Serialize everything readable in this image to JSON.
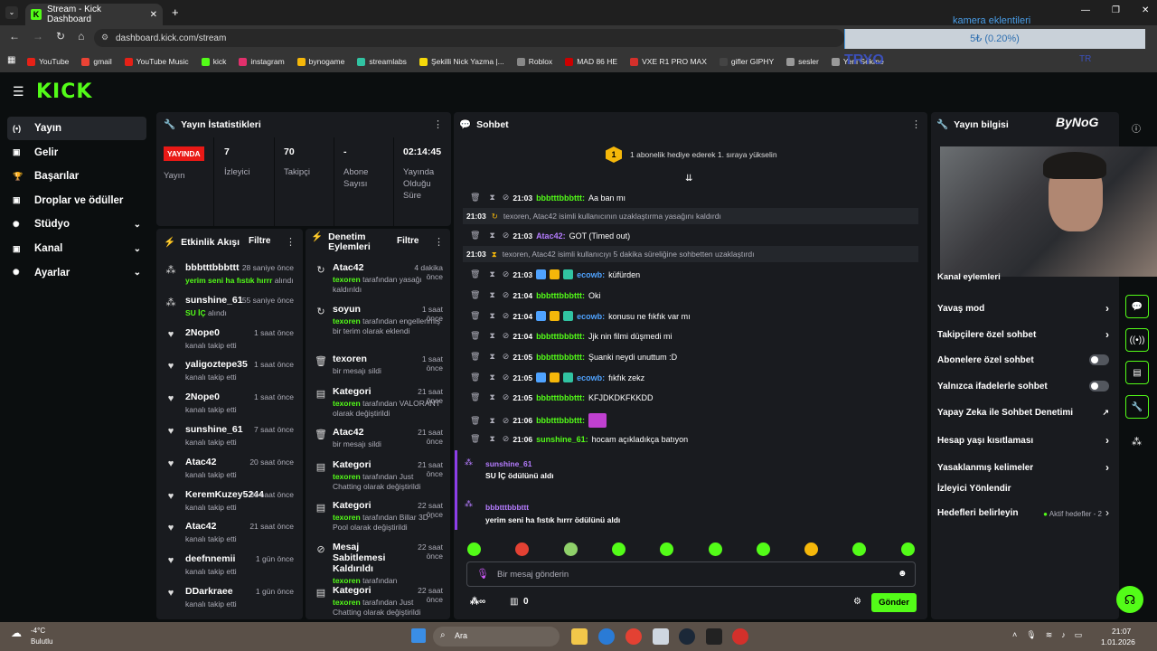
{
  "browser": {
    "tab_title": "Stream - Kick Dashboard",
    "url": "dashboard.kick.com/stream",
    "bookmarks": [
      "YouTube",
      "gmail",
      "YouTube Music",
      "kick",
      "instagram",
      "bynogame",
      "streamlabs",
      "Şekilli Nick Yazma |...",
      "Roblox",
      "MAD 86 HE",
      "VXE R1 PRO MAX",
      "gifler GIPHY",
      "sesler",
      "Yeni Sekme"
    ]
  },
  "overlay": {
    "title": "kamera eklentileri",
    "progress_text": "5₺ (0.20%)",
    "tryo": "TRYO",
    "tr": "TR",
    "bynogame": "ByNoG"
  },
  "sidebar": {
    "items": [
      {
        "label": "Yayın",
        "icon": "(•)"
      },
      {
        "label": "Gelir",
        "icon": "▣"
      },
      {
        "label": "Başarılar",
        "icon": "🏆"
      },
      {
        "label": "Droplar ve ödüller",
        "icon": "▣"
      },
      {
        "label": "Stüdyo",
        "icon": "✺"
      },
      {
        "label": "Kanal",
        "icon": "▣"
      },
      {
        "label": "Ayarlar",
        "icon": "✺"
      }
    ]
  },
  "stats": {
    "title": "Yayın İstatistikleri",
    "live": "YAYINDA",
    "live_label": "Yayın",
    "viewers": "7",
    "viewers_label": "İzleyici",
    "followers": "70",
    "followers_label": "Takipçi",
    "subs": "-",
    "subs_label": "Abone Sayısı",
    "uptime": "02:14:45",
    "uptime_label": "Yayında Olduğu Süre"
  },
  "activity": {
    "title": "Etkinlik Akışı",
    "filter": "Filtre",
    "items": [
      {
        "user": "bbbtttbbbttt",
        "time": "28 saniye önce",
        "text": "yerim seni ha fıstık hırrr",
        "suffix": " alındı",
        "green": true
      },
      {
        "user": "sunshine_61",
        "time": "55 saniye önce",
        "text": "SU İÇ",
        "suffix": " alındı",
        "green": true
      },
      {
        "user": "2Nope0",
        "time": "1 saat önce",
        "text": "kanalı takip etti"
      },
      {
        "user": "yaligoztepe35",
        "time": "1 saat önce",
        "text": "kanalı takip etti"
      },
      {
        "user": "2Nope0",
        "time": "1 saat önce",
        "text": "kanalı takip etti"
      },
      {
        "user": "sunshine_61",
        "time": "7 saat önce",
        "text": "kanalı takip etti"
      },
      {
        "user": "Atac42",
        "time": "20 saat önce",
        "text": "kanalı takip etti"
      },
      {
        "user": "KeremKuzey5244",
        "time": "20 saat önce",
        "text": "kanalı takip etti"
      },
      {
        "user": "Atac42",
        "time": "21 saat önce",
        "text": "kanalı takip etti"
      },
      {
        "user": "deefnnemii",
        "time": "1 gün önce",
        "text": "kanalı takip etti"
      },
      {
        "user": "DDarkraee",
        "time": "1 gün önce",
        "text": "kanalı takip etti"
      }
    ]
  },
  "moderation": {
    "title": "Denetim Eylemleri",
    "filter": "Filtre",
    "items": [
      {
        "title": "Atac42",
        "time": "4 dakika önce",
        "actor": "texoren",
        "text": " tarafından yasağı kaldırıldı",
        "icon": "↻"
      },
      {
        "title": "soyun",
        "time": "1 saat önce",
        "actor": "texoren",
        "text": " tarafından engellenmiş bir terim olarak eklendi",
        "icon": "↻"
      },
      {
        "title": "texoren",
        "time": "1 saat önce",
        "actor": "",
        "text": "bir mesajı sildi",
        "icon": "🗑"
      },
      {
        "title": "Kategori",
        "time": "21 saat önce",
        "actor": "texoren",
        "text": " tarafından VALORANT olarak değiştirildi",
        "icon": "▤"
      },
      {
        "title": "Atac42",
        "time": "21 saat önce",
        "actor": "",
        "text": "bir mesajı sildi",
        "icon": "🗑"
      },
      {
        "title": "Kategori",
        "time": "21 saat önce",
        "actor": "texoren",
        "text": " tarafından Just Chatting olarak değiştirildi",
        "icon": "▤"
      },
      {
        "title": "Kategori",
        "time": "22 saat önce",
        "actor": "texoren",
        "text": " tarafından Billar 3D - Pool olarak değiştirildi",
        "icon": "▤"
      },
      {
        "title": "Mesaj Sabitlemesi Kaldırıldı",
        "time": "22 saat önce",
        "actor": "texoren",
        "text": " tarafından",
        "icon": "⊘"
      },
      {
        "title": "Kategori",
        "time": "22 saat önce",
        "actor": "texoren",
        "text": " tarafından Just Chatting olarak değiştirildi",
        "icon": "▤"
      }
    ]
  },
  "chat": {
    "title": "Sohbet",
    "banner": "1 abonelik hediye ederek 1. sıraya yükselin",
    "banner_num": "1",
    "lines": [
      {
        "time": "21:03",
        "user": "bbbtttbbbttt",
        "color": "#53fc18",
        "msg": "Aa ban mı"
      },
      {
        "time": "21:03",
        "user": "Atac42",
        "color": "#b57cff",
        "msg": "GOT (Timed out)"
      },
      {
        "time": "21:03",
        "user": "ecowb",
        "color": "#4fa3ff",
        "msg": "küfürden"
      },
      {
        "time": "21:04",
        "user": "bbbtttbbbttt",
        "color": "#53fc18",
        "msg": "Oki"
      },
      {
        "time": "21:04",
        "user": "ecowb",
        "color": "#4fa3ff",
        "msg": "konusu ne fıkfık var mı"
      },
      {
        "time": "21:04",
        "user": "bbbtttbbbttt",
        "color": "#53fc18",
        "msg": "Jjk nin filmi düşmedi mi"
      },
      {
        "time": "21:05",
        "user": "bbbtttbbbttt",
        "color": "#53fc18",
        "msg": "Şuanki neydi unuttum :D"
      },
      {
        "time": "21:05",
        "user": "ecowb",
        "color": "#4fa3ff",
        "msg": "fıkfık zekz"
      },
      {
        "time": "21:05",
        "user": "bbbtttbbbttt",
        "color": "#53fc18",
        "msg": "KFJDKDKFKKDD"
      },
      {
        "time": "21:06",
        "user": "bbbtttbbbttt",
        "color": "#53fc18",
        "msg": ""
      },
      {
        "time": "21:06",
        "user": "sunshine_61",
        "color": "#53fc18",
        "msg": "hocam açıkladıkça batıyon"
      }
    ],
    "sys1_time": "21:03",
    "sys1": "texoren, Atac42 isimli kullanıcının uzaklaştırma yasağını kaldırdı",
    "sys2_time": "21:03",
    "sys2": "texoren, Atac42 isimli kullanıcıyı 5 dakika süreliğine sohbetten uzaklaştırdı",
    "reward1_user": "sunshine_61",
    "reward1_text": "SU İÇ ödülünü aldı",
    "reward2_user": "bbbtttbbbttt",
    "reward2_text": "yerim seni ha fıstık hırrr ödülünü aldı",
    "input_placeholder": "Bir mesaj gönderin",
    "points": "0",
    "send": "Gönder"
  },
  "info": {
    "title": "Yayın bilgisi",
    "mod_label": "Kanal eylemleri",
    "settings": [
      {
        "label": "Yavaş mod",
        "kind": "chev"
      },
      {
        "label": "Takipçilere özel sohbet",
        "kind": "chev"
      },
      {
        "label": "Abonelere özel sohbet",
        "kind": "toggle"
      },
      {
        "label": "Yalnızca ifadelerle sohbet",
        "kind": "toggle"
      },
      {
        "label": "Yapay Zeka ile Sohbet Denetimi",
        "kind": "ext"
      },
      {
        "label": "Hesap yaşı kısıtlaması",
        "kind": "chev"
      },
      {
        "label": "Yasaklanmış kelimeler",
        "kind": "chev"
      },
      {
        "label": "İzleyici Yönlendir",
        "kind": "none"
      },
      {
        "label": "Hedefleri belirleyin",
        "kind": "goal"
      }
    ],
    "goal_text": "Aktif hedefler - 2"
  },
  "taskbar": {
    "temp": "-4°C",
    "weather": "Bulutlu",
    "search": "Ara",
    "time": "21:07",
    "date": "1.01.2026"
  }
}
